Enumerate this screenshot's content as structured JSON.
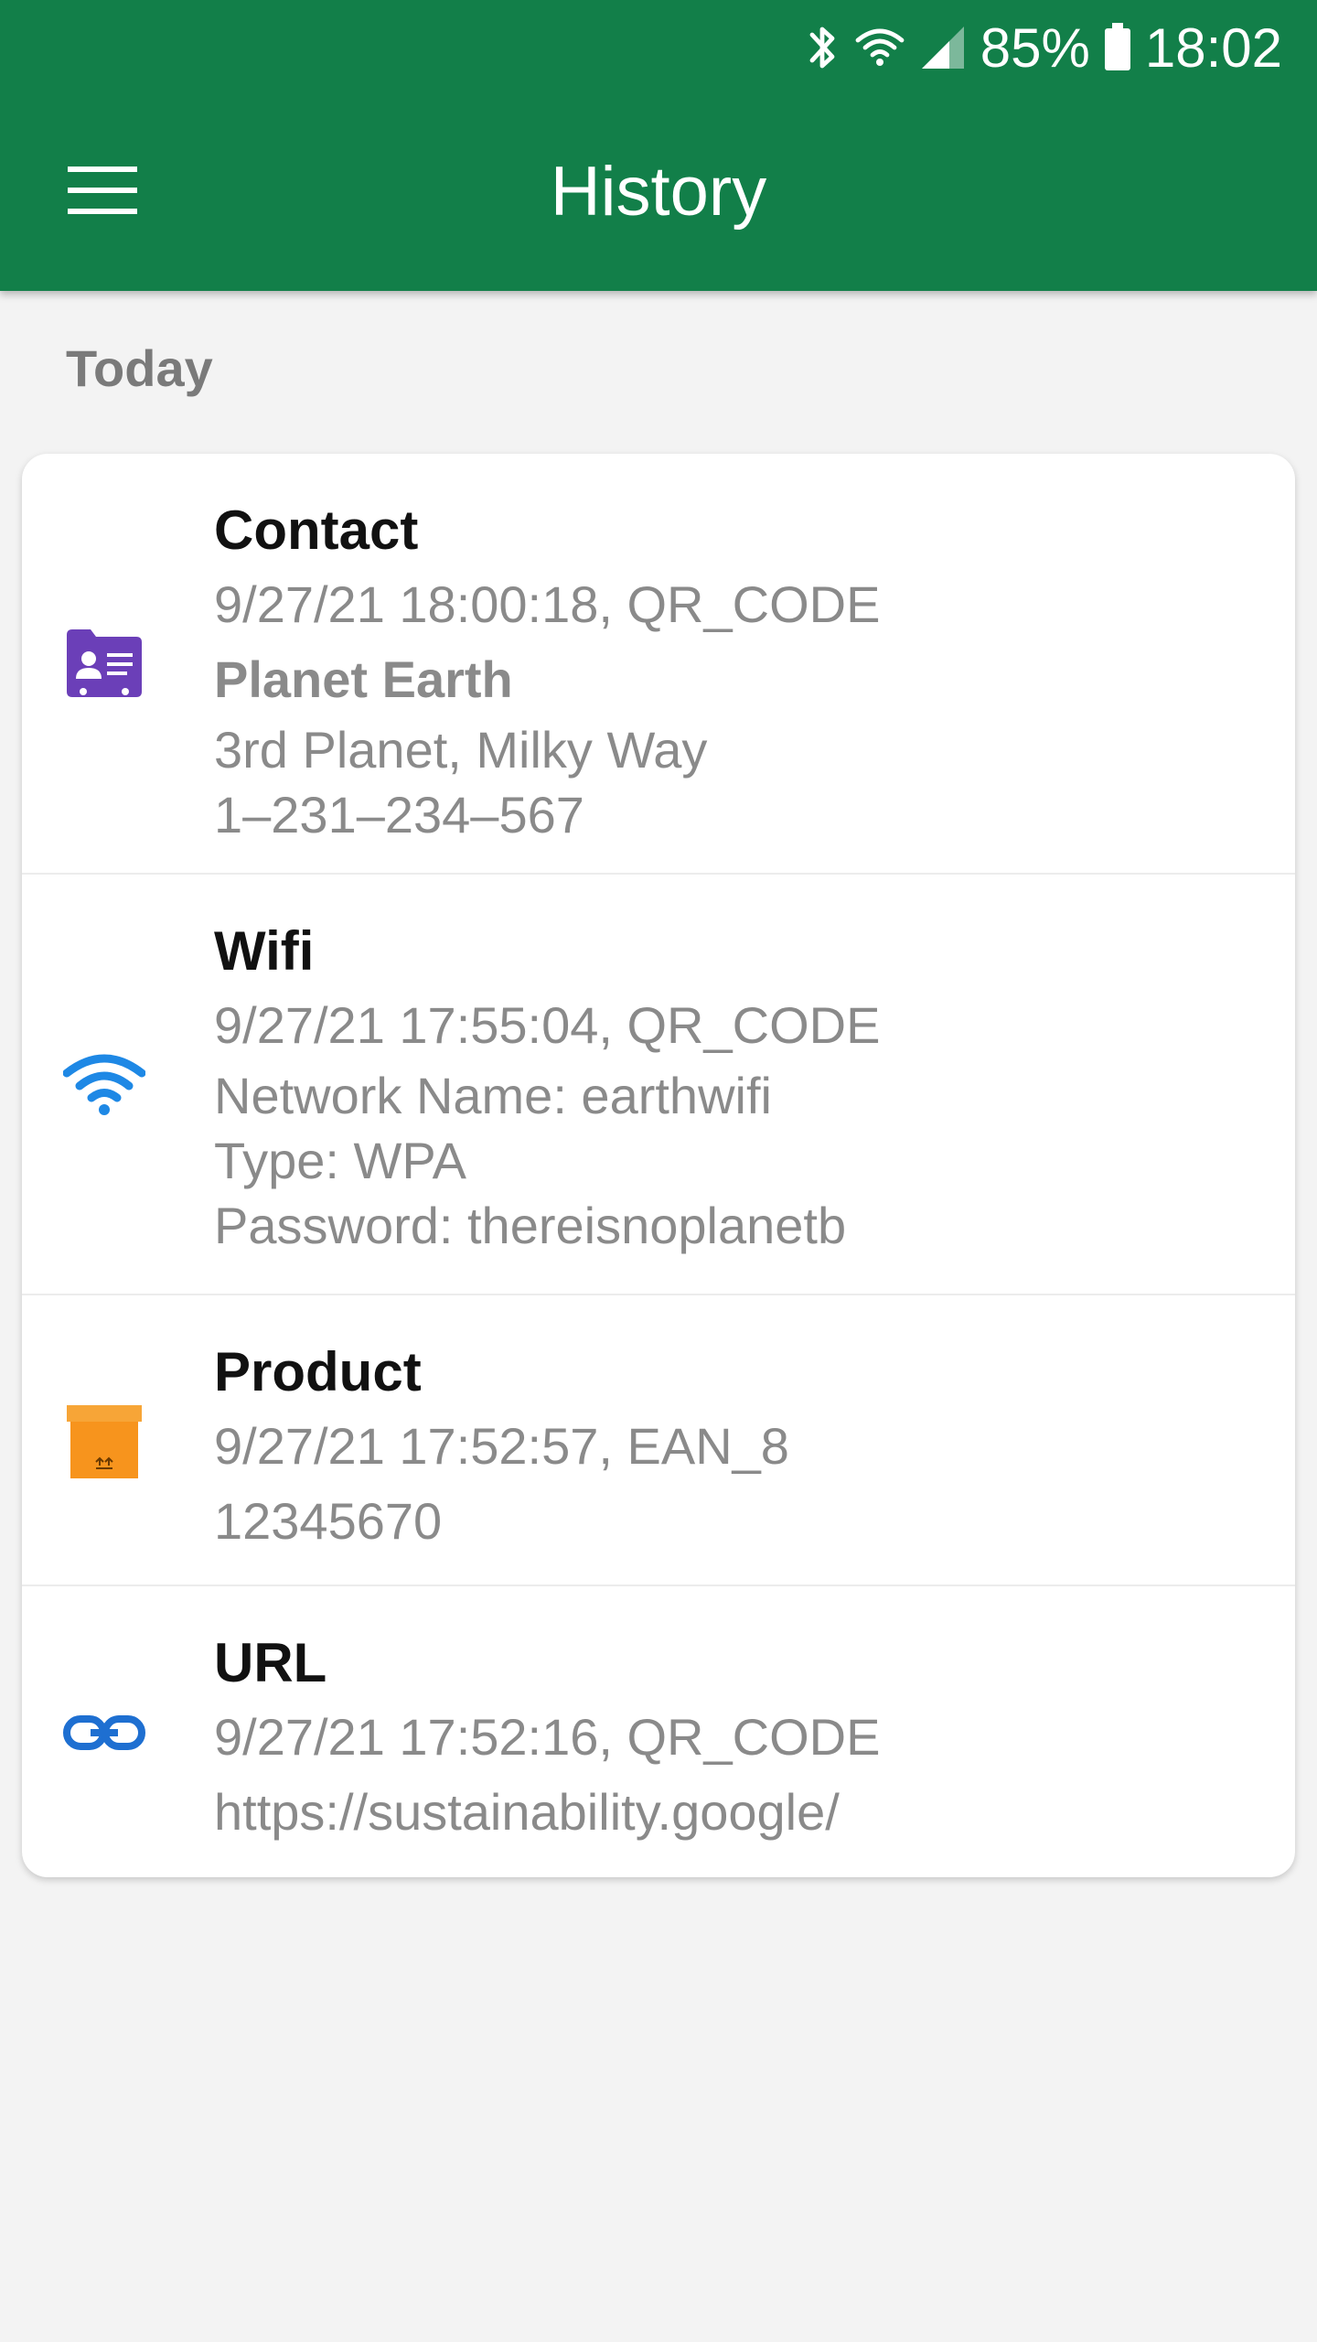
{
  "status_bar": {
    "battery": "85%",
    "time": "18:02",
    "icons": [
      "bluetooth-icon",
      "wifi-icon",
      "signal-icon",
      "battery-icon"
    ]
  },
  "app_bar": {
    "menu_icon": "hamburger-menu-icon",
    "title": "History",
    "color": "#127f49"
  },
  "history": {
    "section": "Today",
    "items": [
      {
        "type": "Contact",
        "icon": "contact-card-icon",
        "icon_color": "#6b3fb8",
        "meta": "9/27/21 18:00:18, QR_CODE",
        "name": "Planet Earth",
        "lines": [
          "3rd Planet,  Milky Way",
          "1–231–234–567"
        ]
      },
      {
        "type": "Wifi",
        "icon": "wifi-icon",
        "icon_color": "#1e88e5",
        "meta": "9/27/21 17:55:04, QR_CODE",
        "lines": [
          "Network Name: earthwifi",
          "Type: WPA",
          "Password: thereisnoplanetb"
        ]
      },
      {
        "type": "Product",
        "icon": "package-box-icon",
        "icon_color": "#f7941d",
        "meta": "9/27/21 17:52:57, EAN_8",
        "lines": [
          "12345670"
        ]
      },
      {
        "type": "URL",
        "icon": "link-icon",
        "icon_color": "#1e6fd1",
        "meta": "9/27/21 17:52:16, QR_CODE",
        "lines": [
          "https://sustainability.google/"
        ]
      }
    ]
  }
}
